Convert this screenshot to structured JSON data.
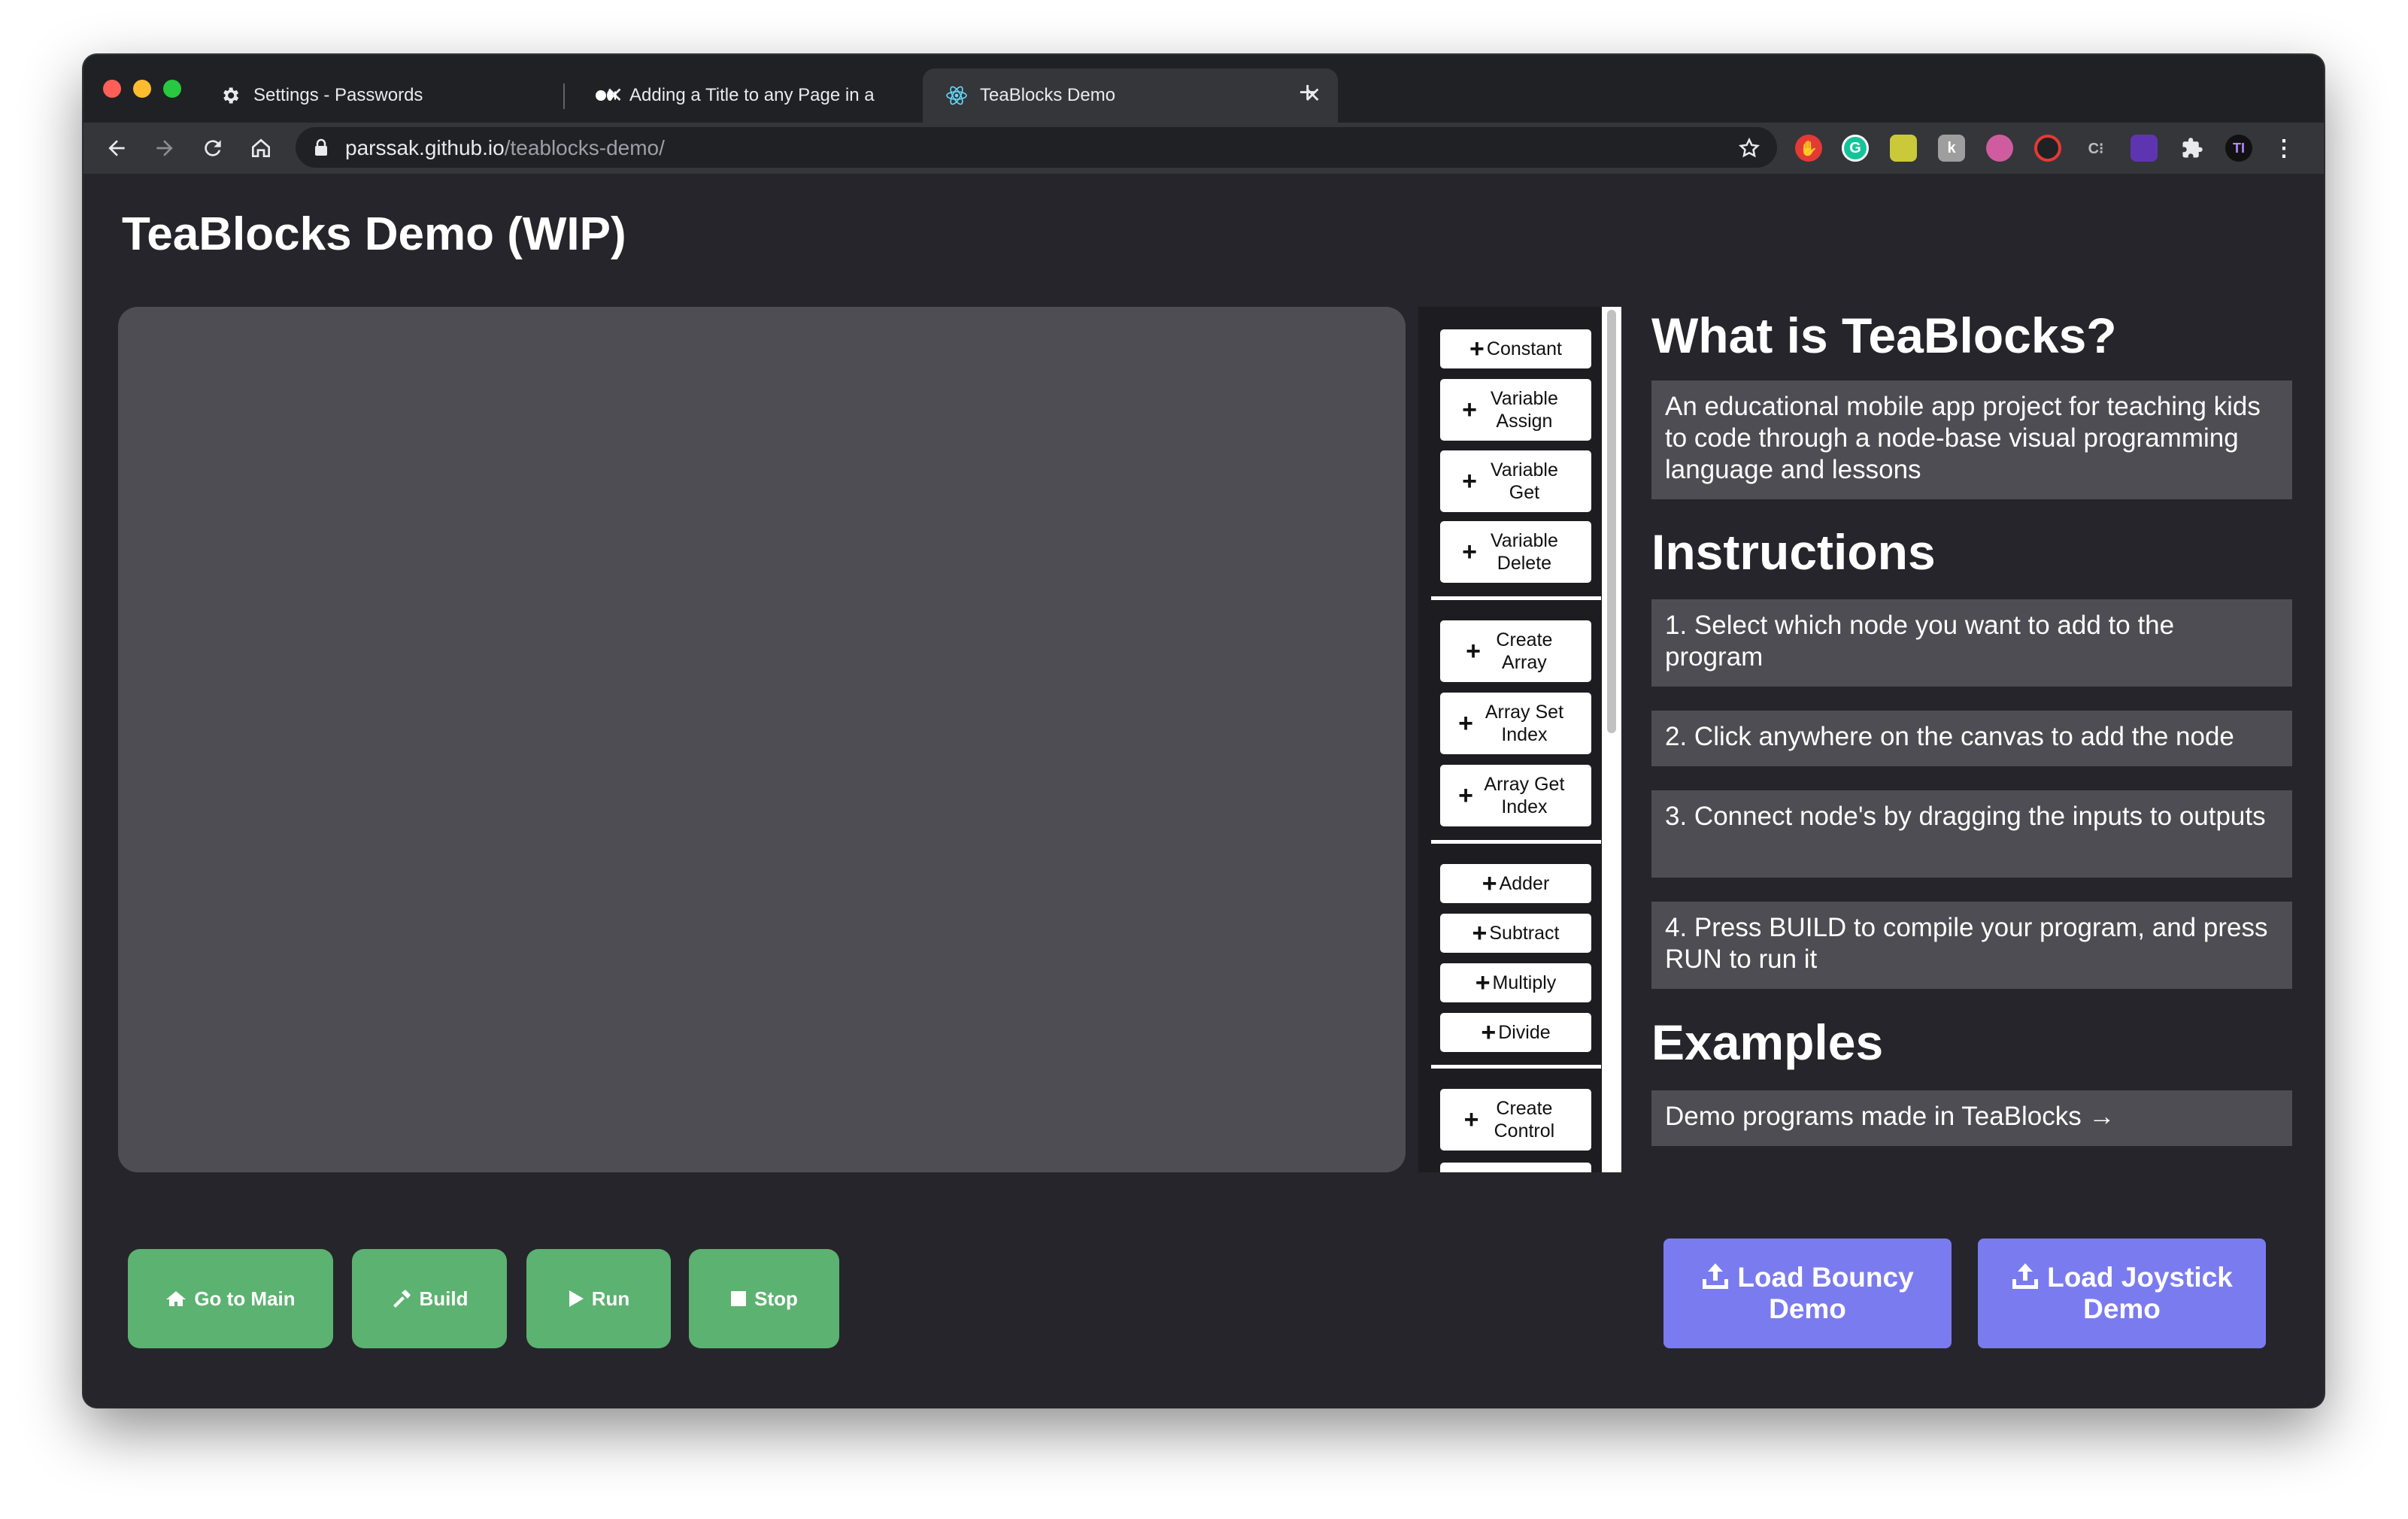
{
  "browser": {
    "tabs": [
      {
        "title": "Settings - Passwords",
        "icon": "gear-icon"
      },
      {
        "title": "Adding a Title to any Page in a",
        "icon": "medium-icon"
      },
      {
        "title": "TeaBlocks Demo",
        "icon": "react-icon"
      }
    ],
    "url_host": "parssak.github.io",
    "url_path": "/teablocks-demo/"
  },
  "page": {
    "title": "TeaBlocks Demo (WIP)"
  },
  "palette": {
    "groups": [
      [
        "Constant",
        "Variable Assign",
        "Variable Get",
        "Variable Delete"
      ],
      [
        "Create Array",
        "Array Set Index",
        "Array Get Index"
      ],
      [
        "Adder",
        "Subtract",
        "Multiply",
        "Divide"
      ],
      [
        "Create Control"
      ]
    ]
  },
  "info": {
    "what_heading": "What is TeaBlocks?",
    "what_text": "An educational mobile app project for teaching kids to code through a node-base visual programming language and lessons",
    "instructions_heading": "Instructions",
    "instructions": [
      "1. Select which node you want to add to the program",
      "2. Click anywhere on the canvas to add the node",
      "3. Connect node's by dragging the inputs to outputs",
      "4. Press BUILD to compile your program, and press RUN to run it"
    ],
    "examples_heading": "Examples",
    "examples_link": "Demo programs made in TeaBlocks →"
  },
  "actions": {
    "go_to_main": "Go to Main",
    "build": "Build",
    "run": "Run",
    "stop": "Stop"
  },
  "demos": {
    "bouncy": "Load Bouncy Demo",
    "joystick": "Load Joystick Demo"
  },
  "colors": {
    "action_green": "#5cb270",
    "demo_purple": "#7b7bf0",
    "canvas": "#4e4d53",
    "page_bg": "#26252b"
  }
}
